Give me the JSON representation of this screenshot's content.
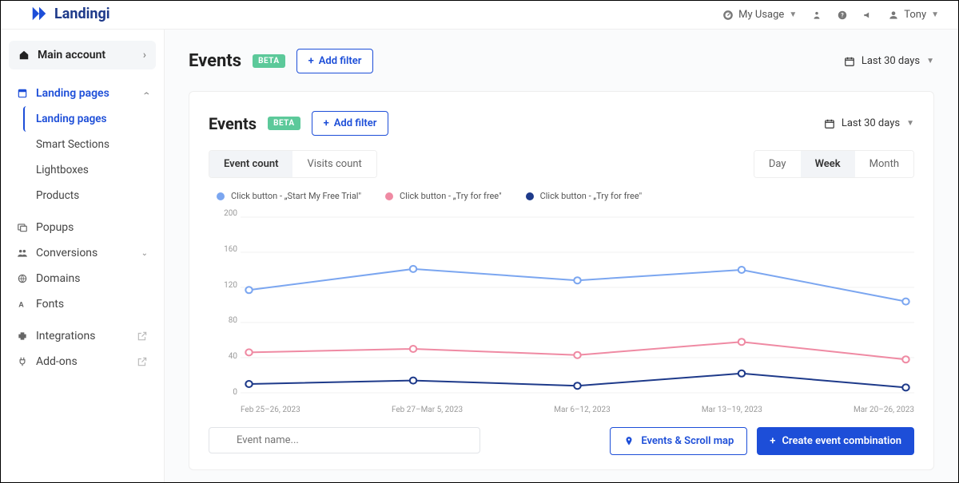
{
  "brand": "Landingi",
  "topbar": {
    "usage_label": "My Usage",
    "user_name": "Tony"
  },
  "sidebar": {
    "account_label": "Main account",
    "groups": [
      {
        "label": "Landing pages",
        "active": true,
        "expanded": true,
        "children": [
          {
            "label": "Landing pages",
            "active": true
          },
          {
            "label": "Smart Sections"
          },
          {
            "label": "Lightboxes"
          },
          {
            "label": "Products"
          }
        ]
      },
      {
        "label": "Popups"
      },
      {
        "label": "Conversions",
        "expandable": true
      },
      {
        "label": "Domains"
      },
      {
        "label": "Fonts"
      },
      {
        "label": "Integrations",
        "external": true
      },
      {
        "label": "Add-ons",
        "external": true
      }
    ]
  },
  "page": {
    "title": "Events",
    "badge": "BETA",
    "add_filter_label": "Add filter",
    "date_range_label": "Last 30 days",
    "count_tabs": [
      "Event count",
      "Visits count"
    ],
    "count_tab_active": 0,
    "range_tabs": [
      "Day",
      "Week",
      "Month"
    ],
    "range_tab_active": 1,
    "legend": [
      {
        "label": "Click button - „Start My Free Trial\"",
        "color": "#7ba6f0"
      },
      {
        "label": "Click button - „Try for free\"",
        "color": "#ef8aa3"
      },
      {
        "label": "Click button - „Try for free\"",
        "color": "#1e3a8a"
      }
    ],
    "search_placeholder": "Event name...",
    "events_map_label": "Events & Scroll map",
    "create_combo_label": "Create event combination"
  },
  "chart_data": {
    "type": "line",
    "ylabel": "",
    "xlabel": "",
    "ylim": [
      0,
      200
    ],
    "y_ticks": [
      200,
      160,
      120,
      80,
      40,
      0
    ],
    "categories": [
      "Feb 25–26, 2023",
      "Feb 27–Mar 5, 2023",
      "Mar 6–12, 2023",
      "Mar 13–19, 2023",
      "Mar 20–26, 2023"
    ],
    "series": [
      {
        "name": "Click button - „Start My Free Trial\"",
        "color": "#7ba6f0",
        "values": [
          117,
          141,
          128,
          140,
          104
        ]
      },
      {
        "name": "Click button - „Try for free\"",
        "color": "#ef8aa3",
        "values": [
          46,
          50,
          43,
          58,
          38
        ]
      },
      {
        "name": "Click button - „Try for free\"",
        "color": "#1e3a8a",
        "values": [
          10,
          14,
          8,
          22,
          6
        ]
      }
    ]
  }
}
